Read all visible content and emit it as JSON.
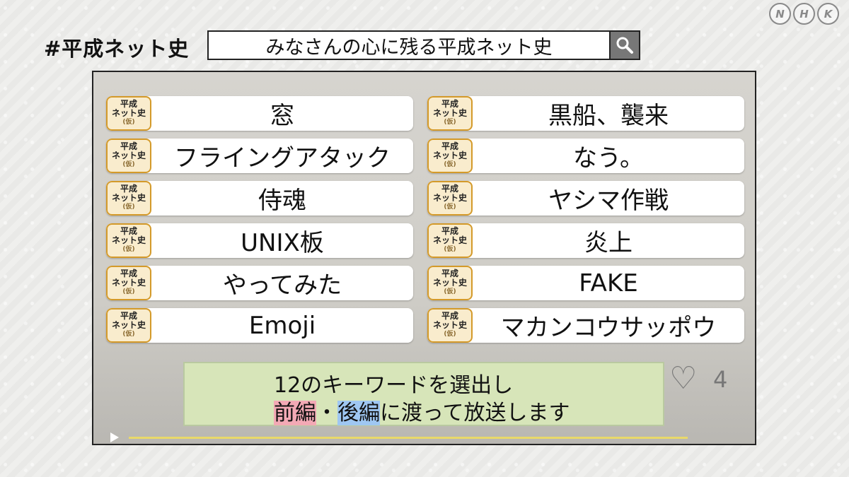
{
  "broadcaster_logo": [
    "N",
    "H",
    "K"
  ],
  "hashtag": "#平成ネット史",
  "search": {
    "query": "みなさんの心に残る平成ネット史",
    "button_icon": "search-icon"
  },
  "badge": {
    "line1": "平成",
    "line2": "ネット史",
    "line3": "(仮)"
  },
  "keywords_left": [
    "窓",
    "フライングアタック",
    "侍魂",
    "UNIX板",
    "やってみた",
    "Emoji"
  ],
  "keywords_right": [
    "黒船、襲来",
    "なう。",
    "ヤシマ作戦",
    "炎上",
    "FAKE",
    "マカンコウサッポウ"
  ],
  "background_post": {
    "heart_icon": "heart-icon",
    "like_count": "4"
  },
  "caption": {
    "line1": "12のキーワードを選出し",
    "part1": "前編",
    "sep": "・",
    "part2": "後編",
    "rest": "に渡って放送します"
  },
  "colors": {
    "badge_border": "#d49a2a",
    "badge_fill": "#f9eccd",
    "caption_bg": "#d7e5b9",
    "highlight_red": "#f3a9b5",
    "highlight_blue": "#9fc7f2"
  }
}
